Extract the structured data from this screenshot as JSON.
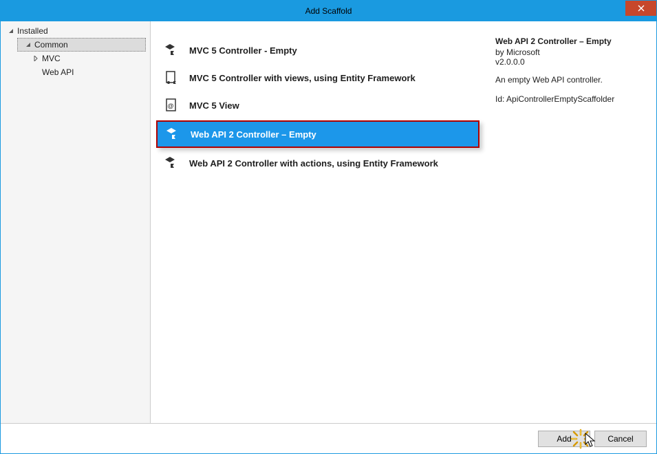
{
  "window": {
    "title": "Add Scaffold"
  },
  "sidebar": {
    "root": {
      "label": "Installed"
    },
    "common": {
      "label": "Common"
    },
    "children": [
      {
        "label": "MVC"
      },
      {
        "label": "Web API"
      }
    ]
  },
  "list": {
    "items": [
      {
        "label": "MVC 5 Controller - Empty",
        "selected": false
      },
      {
        "label": "MVC 5 Controller with views, using Entity Framework",
        "selected": false
      },
      {
        "label": "MVC 5 View",
        "selected": false
      },
      {
        "label": "Web API 2 Controller – Empty",
        "selected": true
      },
      {
        "label": "Web API 2 Controller with actions, using Entity Framework",
        "selected": false
      }
    ]
  },
  "details": {
    "title": "Web API 2 Controller – Empty",
    "by": "by Microsoft",
    "version": "v2.0.0.0",
    "description": "An empty Web API controller.",
    "id_label": "Id: ApiControllerEmptyScaffolder"
  },
  "footer": {
    "add": "Add",
    "cancel": "Cancel"
  }
}
